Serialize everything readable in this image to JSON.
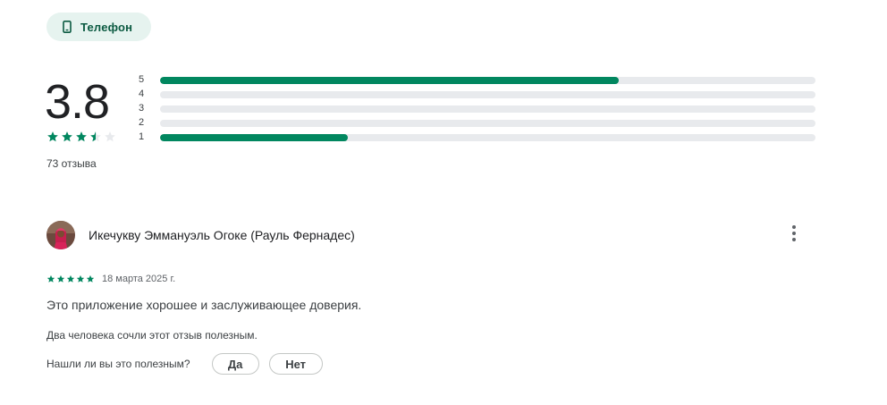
{
  "filter_chip": {
    "label": "Телефон",
    "icon": "phone-icon",
    "color": "#0b5a41"
  },
  "rating_summary": {
    "average": "3.8",
    "average_stars": 3.5,
    "review_count_label": "73 отзыва",
    "histogram": [
      {
        "label": "5",
        "fraction": 0.7
      },
      {
        "label": "4",
        "fraction": 0.0
      },
      {
        "label": "3",
        "fraction": 0.0
      },
      {
        "label": "2",
        "fraction": 0.0
      },
      {
        "label": "1",
        "fraction": 0.286
      }
    ],
    "accent_color": "#01875f"
  },
  "review": {
    "author": "Икечукву Эммануэль Огоке (Рауль Фернадес)",
    "avatar_icon": "user-avatar",
    "stars": 5,
    "date": "18 марта 2025 г.",
    "text": "Это приложение хорошее и заслуживающее доверия.",
    "helpful_count": "Два человека сочли этот отзыв полезным.",
    "helpful_question": "Нашли ли вы это полезным?",
    "yes_label": "Да",
    "no_label": "Нет",
    "more_icon": "more-vert-icon"
  }
}
